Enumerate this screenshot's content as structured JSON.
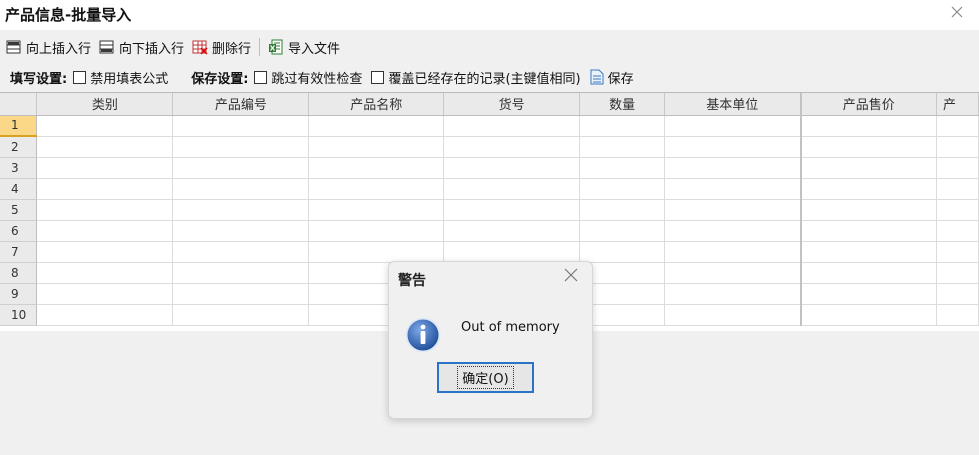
{
  "window": {
    "title": "产品信息-批量导入"
  },
  "toolbar": {
    "insert_above": "向上插入行",
    "insert_below": "向下插入行",
    "delete_row": "删除行",
    "import_file": "导入文件"
  },
  "settings": {
    "fill_label": "填写设置:",
    "disable_formula": "禁用填表公式",
    "save_label": "保存设置:",
    "skip_validation": "跳过有效性检查",
    "overwrite_existing": "覆盖已经存在的记录(主键值相同)",
    "save_button": "保存"
  },
  "grid": {
    "columns": [
      "类别",
      "产品编号",
      "产品名称",
      "货号",
      "数量",
      "基本单位",
      "产品售价",
      "产"
    ],
    "rows": [
      "1",
      "2",
      "3",
      "4",
      "5",
      "6",
      "7",
      "8",
      "9",
      "10"
    ],
    "active_row": "1"
  },
  "dialog": {
    "title": "警告",
    "message": "Out of memory",
    "ok_label": "确定(O)"
  },
  "colors": {
    "accent": "#2a73c6",
    "active_row": "#fbd788",
    "info_icon": "#2b5aa8"
  }
}
